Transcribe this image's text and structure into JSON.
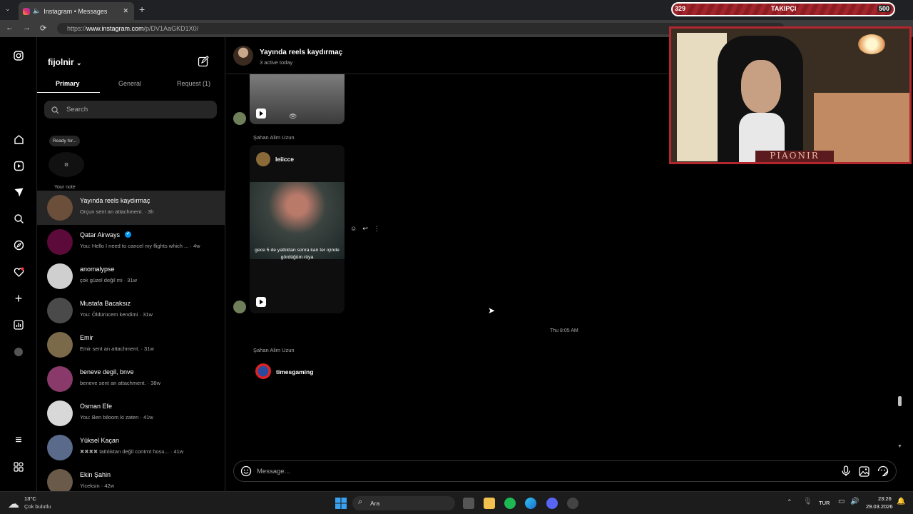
{
  "browser": {
    "tab_title": "Instagram • Messages",
    "url_prefix": "https://",
    "url_host": "www.instagram.com",
    "url_path": "/p/DV1AaGKD1X0/",
    "new_tab_label": "+",
    "close_label": "✕"
  },
  "overlay": {
    "follower_count": "329",
    "follower_label": "TAKIPÇI",
    "goal": "500",
    "webcam_banner": "PIAONIR"
  },
  "sidebar_list": {
    "username": "fijolnir",
    "tabs": [
      "Primary",
      "General",
      "Request (1)"
    ],
    "search_placeholder": "Search",
    "note_bubble": "Ready for...",
    "note_label": "Your note",
    "conversations": [
      {
        "name": "Yayında reels kaydırmaç",
        "preview": "Orçun sent an attachment. · 3h",
        "color": "#6b4f3a"
      },
      {
        "name": "Qatar Airways",
        "preview": "You: Hello I need to cancel my flights which ... · 4w",
        "color": "#5b0a3a",
        "verified": "✔"
      },
      {
        "name": "anomalypse",
        "preview": "çok güzel değil mi · 31w",
        "color": "#cfcfcf"
      },
      {
        "name": "Mustafa Bacaksız",
        "preview": "You: Öldürücem kendimi · 31w",
        "color": "#4a4a4a"
      },
      {
        "name": "Emir",
        "preview": "Emir sent an attachment. · 31w",
        "color": "#7a6a4a"
      },
      {
        "name": "beneve degil, bnve",
        "preview": "beneve sent an attachment. · 38w",
        "color": "#8a3a6a"
      },
      {
        "name": "Osman Efe",
        "preview": "You: Ben biloom ki zaten · 41w",
        "color": "#d8d8d8"
      },
      {
        "name": "Yüksel Kaçan",
        "preview": "✖✖✖✖ tatlılıktan değil contrnt hosu... · 41w",
        "color": "#5a6a8a"
      },
      {
        "name": "Ekin Şahin",
        "preview": "Yiceksin · 42w",
        "color": "#6a5a4a"
      }
    ]
  },
  "chat": {
    "title": "Yayında reels kaydırmaç",
    "subtitle": "3 active today",
    "sender1": "Şahan Alim Uzun",
    "reel_user": "leiicce",
    "reel_caption": "gece 5 de yattıktan sonra kan ter içinde gördüğüm rüya",
    "timestamp": "Thu 8:05 AM",
    "sender2": "Şahan Alim Uzun",
    "reel2_user": "timesgaming",
    "composer_placeholder": "Message..."
  },
  "taskbar": {
    "weather_temp": "13°C",
    "weather_desc": "Çok bulutlu",
    "search_label": "Ara",
    "lang": "TUR",
    "time": "23:26",
    "date": "29.03.2026"
  }
}
